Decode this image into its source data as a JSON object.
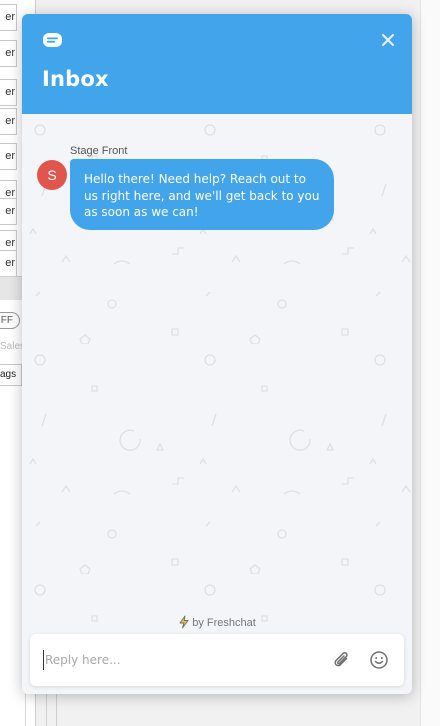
{
  "background": {
    "rows": [
      "er",
      "er",
      "er",
      "er",
      "er",
      "er",
      "er",
      "er",
      "er"
    ],
    "pill_text": "FF",
    "sales_text": "Sales",
    "tags_text": "ags"
  },
  "header": {
    "title": "Inbox",
    "brand_icon": "freshchat-logo-icon",
    "close_icon": "close-icon",
    "close_symbol": "✕"
  },
  "conversation": {
    "sender": "Stage Front",
    "avatar_initial": "S",
    "avatar_color": "#e2554d",
    "message": "Hello there! Need help? Reach out to us right here, and we'll get back to you as soon as we can!"
  },
  "footer": {
    "powered_by": "by Freshchat",
    "bolt_icon": "lightning-bolt-icon"
  },
  "composer": {
    "placeholder": "Reply here...",
    "value": "",
    "attach_icon": "paperclip-icon",
    "emoji_icon": "smiley-icon"
  },
  "colors": {
    "accent": "#42a4eb",
    "panel_bg": "#f4f5f8"
  }
}
